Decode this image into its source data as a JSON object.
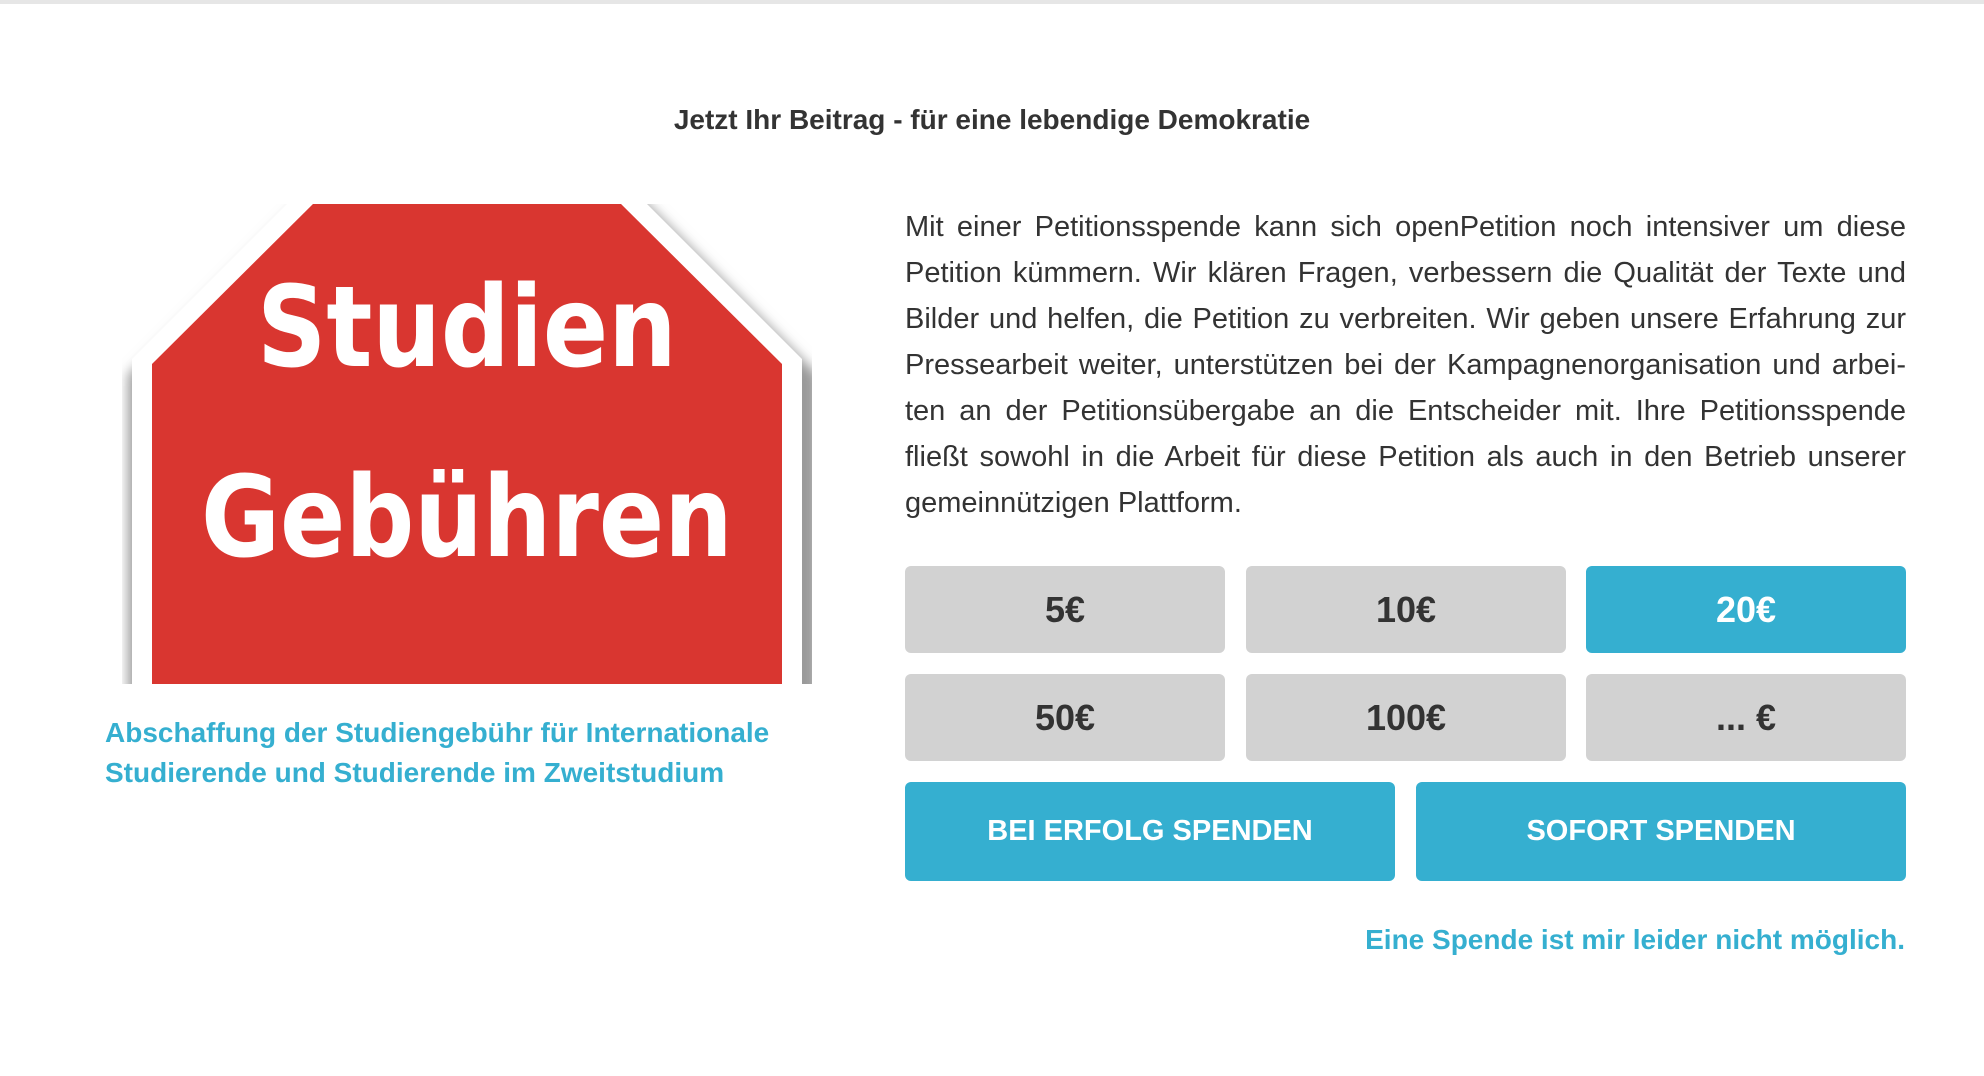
{
  "heading": "Jetzt Ihr Beitrag - für eine lebendige Demokratie",
  "image": {
    "line1": "Studien",
    "line2": "Gebühren",
    "colors": {
      "sign_red": "#d93630",
      "border": "#ffffff",
      "shadow": "#b9b9b9"
    }
  },
  "petition_title": "Abschaffung der Studiengebühr für Internationale Studierende und Studierende im Zweitstudium",
  "description": "Mit einer Petitionsspende kann sich openPetition noch intensiver um diese Petition kümmern. Wir klären Fragen, verbessern die Qualität der Texte und Bilder und helfen, die Petition zu verbreiten. Wir geben unsere Erfahrung zur Pressearbeit weiter, unterstützen bei der Kampagnenorganisation und arbei­ten an der Petitionsübergabe an die Entscheider mit. Ihre Petitionsspende fließt sowohl in die Arbeit für diese Petition als auch in den Betrieb unserer gemeinnützigen Plattform.",
  "amounts": [
    "5€",
    "10€",
    "20€",
    "50€",
    "100€",
    "... €"
  ],
  "selected_amount": "20€",
  "actions": {
    "on_success": "BEI ERFOLG SPENDEN",
    "immediate": "SOFORT SPENDEN"
  },
  "decline_link": "Eine Spende ist mir leider nicht möglich.",
  "colors": {
    "accent": "#35afd0",
    "button_gray": "#d2d2d2",
    "text": "#333333"
  }
}
